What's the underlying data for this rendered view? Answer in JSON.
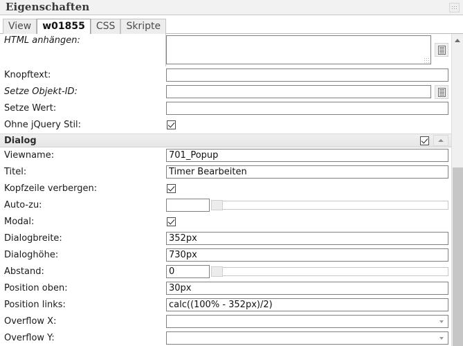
{
  "window": {
    "title": "Eigenschaften",
    "resize_grip_icon": "dots-grip-icon"
  },
  "tabs": [
    {
      "label": "View",
      "active": false
    },
    {
      "label": "w01855",
      "active": true
    },
    {
      "label": "CSS",
      "active": false
    },
    {
      "label": "Skripte",
      "active": false
    }
  ],
  "rows": {
    "html_anhaengen": {
      "label": "HTML anhängen:",
      "value": "",
      "button_icon": "list-picker-icon"
    },
    "knopftext": {
      "label": "Knopftext:",
      "value": ""
    },
    "setze_objekt_id": {
      "label": "Setze Objekt-ID:",
      "value": "",
      "button_icon": "list-picker-icon"
    },
    "setze_wert": {
      "label": "Setze Wert:",
      "value": ""
    },
    "ohne_jquery_stil": {
      "label": "Ohne jQuery Stil:",
      "checked": true
    }
  },
  "section_dialog": {
    "title": "Dialog",
    "checked": true,
    "collapse_icon": "chevron-up-icon"
  },
  "dialog_rows": {
    "viewname": {
      "label": "Viewname:",
      "value": "701_Popup"
    },
    "titel": {
      "label": "Titel:",
      "value": "Timer Bearbeiten"
    },
    "kopfzeile_verbergen": {
      "label": "Kopfzeile verbergen:",
      "checked": true
    },
    "auto_zu": {
      "label": "Auto-zu:",
      "value": "",
      "slider_position": 0
    },
    "modal": {
      "label": "Modal:",
      "checked": true
    },
    "dialogbreite": {
      "label": "Dialogbreite:",
      "value": "352px"
    },
    "dialoghoehe": {
      "label": "Dialoghöhe:",
      "value": "730px"
    },
    "abstand": {
      "label": "Abstand:",
      "value": "0",
      "slider_position": 0
    },
    "position_oben": {
      "label": "Position oben:",
      "value": "30px"
    },
    "position_links": {
      "label": "Position links:",
      "value": "calc((100% - 352px)/2)"
    },
    "overflow_x": {
      "label": "Overflow X:",
      "value": ""
    },
    "overflow_y": {
      "label": "Overflow Y:",
      "value": ""
    }
  },
  "scrollbar": {
    "up_arrow_icon": "chevron-up-icon"
  }
}
